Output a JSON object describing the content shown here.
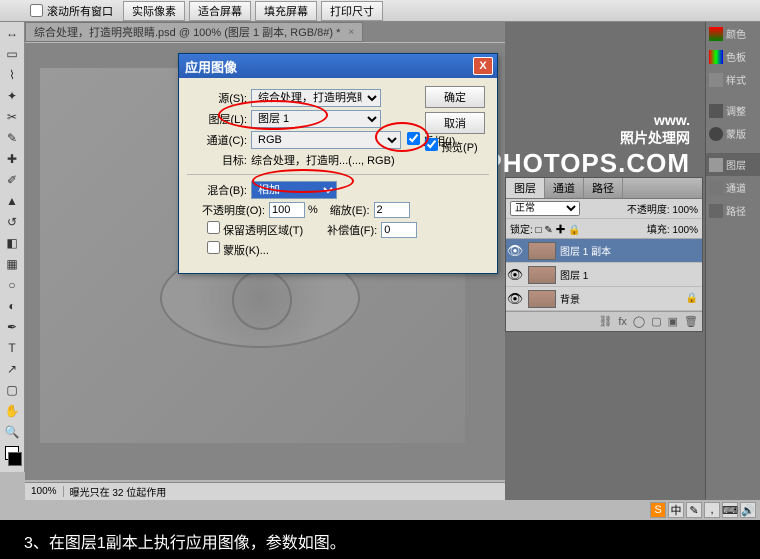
{
  "topbar": {
    "scroll_all": "滚动所有窗口",
    "buttons": [
      "实际像素",
      "适合屏幕",
      "填充屏幕",
      "打印尺寸"
    ]
  },
  "tab": {
    "title": "综合处理，打造明亮眼睛.psd @ 100% (图层 1 副本, RGB/8#) *"
  },
  "statusbar": {
    "zoom": "100%",
    "info": "曝光只在 32 位起作用"
  },
  "watermark": {
    "line1": "www.",
    "line2": "照片处理网",
    "line3": "PHOTOPS.COM"
  },
  "mini": [
    "颜色",
    "色板",
    "样式",
    "调整",
    "蒙版",
    "图层",
    "通道",
    "路径"
  ],
  "layers_panel": {
    "tabs": [
      "图层",
      "通道",
      "路径"
    ],
    "blend": "正常",
    "opacity_lbl": "不透明度:",
    "opacity_val": "100%",
    "lock_lbl": "锁定:",
    "fill_lbl": "填充:",
    "fill_val": "100%",
    "rows": [
      {
        "name": "图层 1 副本",
        "sel": true
      },
      {
        "name": "图层 1",
        "sel": false
      },
      {
        "name": "背景",
        "sel": false,
        "lock": true
      }
    ]
  },
  "dialog": {
    "title": "应用图像",
    "src_lbl": "源(S):",
    "src_val": "综合处理，打造明亮眼睛...",
    "layer_lbl": "图层(L):",
    "layer_val": "图层 1",
    "chan_lbl": "通道(C):",
    "chan_val": "RGB",
    "invert_lbl": "反相(I)",
    "target_lbl": "目标:",
    "target_val": "综合处理，打造明...(..., RGB)",
    "blend_lbl": "混合(B):",
    "blend_val": "相加",
    "opacity_lbl": "不透明度(O):",
    "opacity_val": "100",
    "pct": "%",
    "scale_lbl": "缩放(E):",
    "scale_val": "2",
    "offset_lbl": "补偿值(F):",
    "offset_val": "0",
    "preserve_lbl": "保留透明区域(T)",
    "mask_lbl": "蒙版(K)...",
    "ok": "确定",
    "cancel": "取消",
    "preview": "预览(P)"
  },
  "caption": "3、在图层1副本上执行应用图像，参数如图。"
}
